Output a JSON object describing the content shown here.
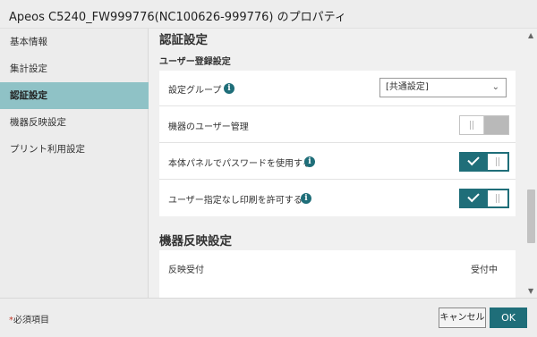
{
  "window": {
    "title": "Apeos C5240_FW999776(NC100626-999776) のプロパティ"
  },
  "sidebar": {
    "items": [
      {
        "label": "基本情報",
        "active": false
      },
      {
        "label": "集計設定",
        "active": false
      },
      {
        "label": "認証設定",
        "active": true
      },
      {
        "label": "機器反映設定",
        "active": false
      },
      {
        "label": "プリント利用設定",
        "active": false
      }
    ]
  },
  "auth": {
    "title": "認証設定",
    "subtitle": "ユーザー登録設定",
    "rows": {
      "group": {
        "label": "設定グループ",
        "select_value": "[共通設定]",
        "info_icon": "info-icon"
      },
      "user_mgmt": {
        "label": "機器のユーザー管理",
        "toggle_on": false
      },
      "panel_password": {
        "label": "本体パネルでパスワードを使用する",
        "toggle_on": true,
        "info_icon": "info-icon"
      },
      "unspecified_print": {
        "label": "ユーザー指定なし印刷を許可する",
        "toggle_on": true,
        "info_icon": "info-icon"
      }
    }
  },
  "device_reflect": {
    "title": "機器反映設定",
    "rows": {
      "receive": {
        "label": "反映受付",
        "value": "受付中"
      }
    }
  },
  "footer": {
    "required_asterisk": "*",
    "required_text": "必須項目",
    "cancel_label": "キャンセル",
    "ok_label": "OK"
  },
  "colors": {
    "accent": "#1f6e79",
    "nav_active": "#8fc2c6",
    "toggle_off_track": "#b9b9b9"
  },
  "icons": {
    "select_chevron": "chevron-down-icon",
    "scroll_up": "scroll-up-arrow-icon",
    "scroll_down": "scroll-down-arrow-icon"
  }
}
